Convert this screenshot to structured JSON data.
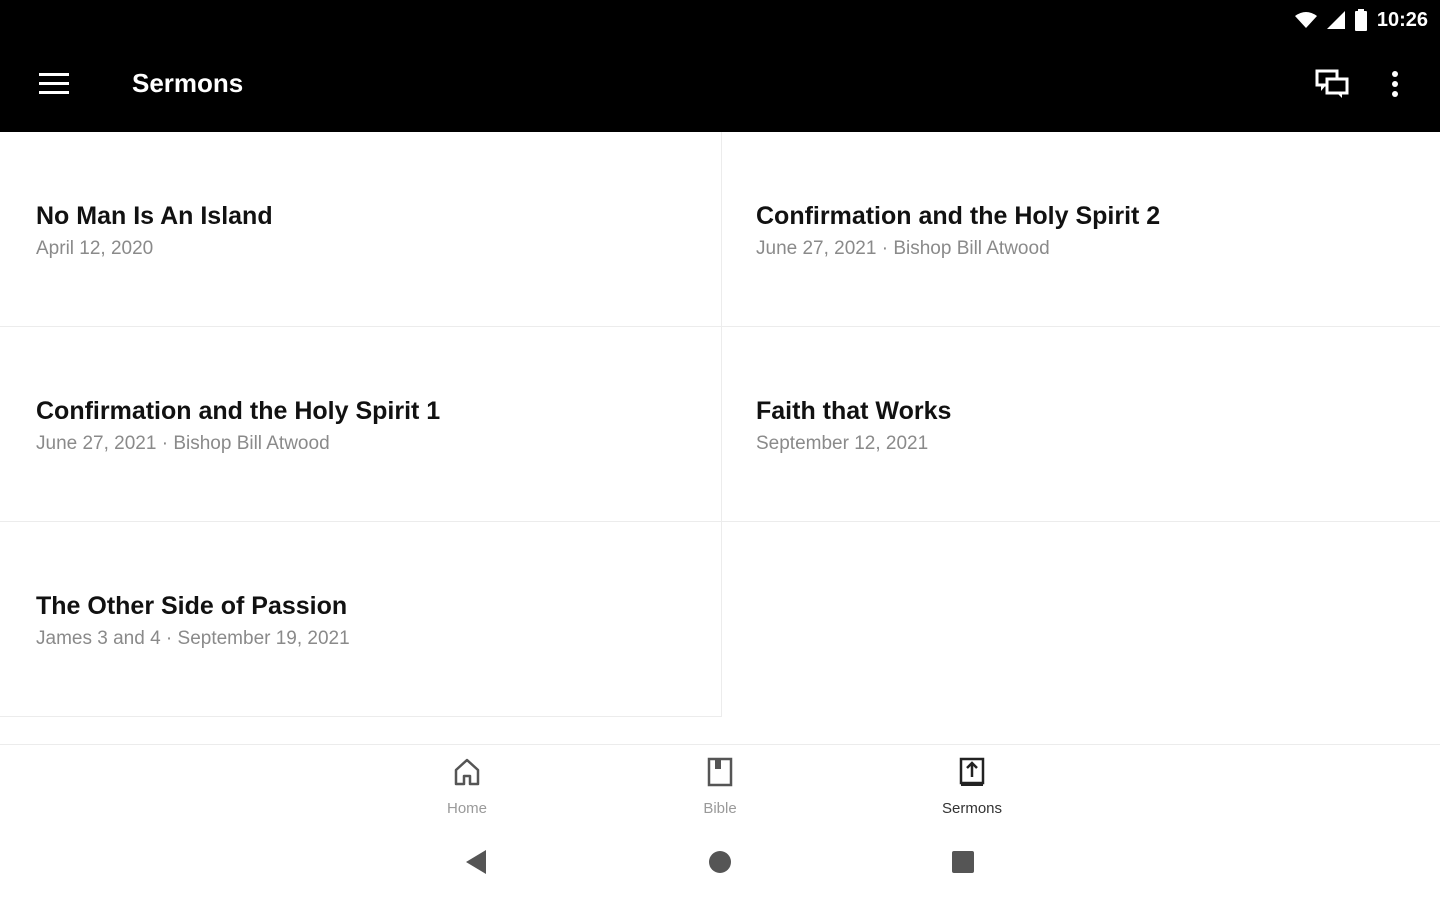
{
  "status_bar": {
    "time": "10:26",
    "icons": [
      "wifi-icon",
      "signal-icon",
      "battery-icon"
    ]
  },
  "app_bar": {
    "title": "Sermons",
    "icons": [
      "menu-icon",
      "chat-icon",
      "more-vert-icon"
    ]
  },
  "sermons": [
    {
      "title": "No Man Is An Island",
      "meta": "April 12, 2020"
    },
    {
      "title": "Confirmation and the Holy Spirit 2",
      "meta": "June 27, 2021 · Bishop Bill Atwood"
    },
    {
      "title": "Confirmation and the Holy Spirit 1",
      "meta": "June 27, 2021 · Bishop Bill Atwood"
    },
    {
      "title": "Faith that Works",
      "meta": "September 12, 2021"
    },
    {
      "title": "The Other Side of Passion",
      "meta": "James 3 and 4 · September 19, 2021"
    }
  ],
  "bottom_nav": {
    "items": [
      {
        "label": "Home",
        "icon": "home-icon"
      },
      {
        "label": "Bible",
        "icon": "book-icon"
      },
      {
        "label": "Sermons",
        "icon": "sermon-book-icon",
        "active": true
      }
    ]
  },
  "system_nav": {
    "icons": [
      "back-icon",
      "home-circle-icon",
      "recents-icon"
    ]
  },
  "colors": {
    "app_bar": "#000000",
    "background": "#ffffff",
    "meta_text": "#8a8a8a",
    "divider": "#ececec"
  }
}
